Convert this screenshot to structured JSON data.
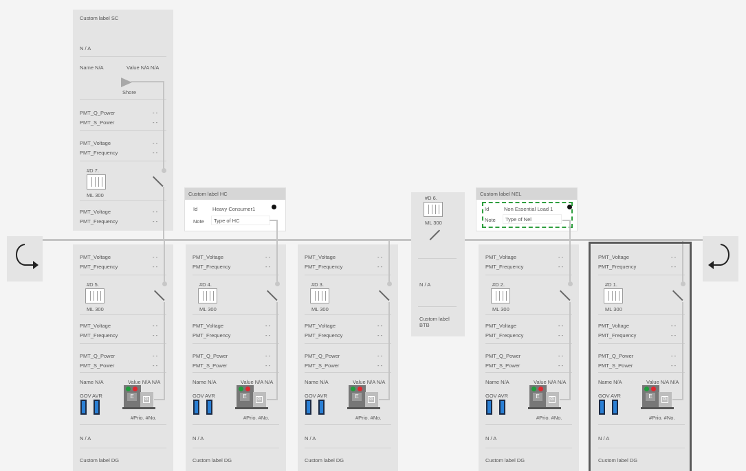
{
  "shore": {
    "label": "Custom label SC",
    "status": "N / A",
    "name": "Name N/A",
    "value": "Value N/A  N/A",
    "shore_text": "Shore",
    "q_power": "PMT_Q_Power",
    "s_power": "PMT_S_Power",
    "voltage": "PMT_Voltage",
    "frequency": "PMT_Frequency",
    "breaker_id": "#D 7.",
    "breaker_type": "ML 300",
    "voltage2": "PMT_Voltage",
    "frequency2": "PMT_Frequency",
    "dash": "- -"
  },
  "hc_card": {
    "header": "Custom label HC",
    "id_label": "Id",
    "id_value": "Heavy Consumer1",
    "note_label": "Note",
    "note_value": "Type of HC"
  },
  "nel_card": {
    "header": "Custom label NEL",
    "id_label": "Id",
    "id_value": "Non Essential Load 1",
    "note_label": "Note",
    "note_value": "Type of Nel"
  },
  "btb": {
    "breaker_id": "#D 6.",
    "breaker_type": "ML 300",
    "status": "N / A",
    "label": "Custom label BTB"
  },
  "generators": [
    {
      "voltage": "PMT_Voltage",
      "frequency": "PMT_Frequency",
      "breaker_id": "#D 5.",
      "breaker_type": "ML 300",
      "voltage2": "PMT_Voltage",
      "frequency2": "PMT_Frequency",
      "q_power": "PMT_Q_Power",
      "s_power": "PMT_S_Power",
      "name": "Name N/A",
      "value": "Value N/A  N/A",
      "gov": "GOV",
      "avr": "AVR",
      "prio": "#Prio. #No.",
      "status": "N / A",
      "label": "Custom label DG",
      "e": "E",
      "g": "G",
      "dash": "- -"
    },
    {
      "voltage": "PMT_Voltage",
      "frequency": "PMT_Frequency",
      "breaker_id": "#D 4.",
      "breaker_type": "ML 300",
      "voltage2": "PMT_Voltage",
      "frequency2": "PMT_Frequency",
      "q_power": "PMT_Q_Power",
      "s_power": "PMT_S_Power",
      "name": "Name N/A",
      "value": "Value N/A  N/A",
      "gov": "GOV",
      "avr": "AVR",
      "prio": "#Prio. #No.",
      "status": "N / A",
      "label": "Custom label DG",
      "e": "E",
      "g": "G",
      "dash": "- -"
    },
    {
      "voltage": "PMT_Voltage",
      "frequency": "PMT_Frequency",
      "breaker_id": "#D 3.",
      "breaker_type": "ML 300",
      "voltage2": "PMT_Voltage",
      "frequency2": "PMT_Frequency",
      "q_power": "PMT_Q_Power",
      "s_power": "PMT_S_Power",
      "name": "Name N/A",
      "value": "Value N/A  N/A",
      "gov": "GOV",
      "avr": "AVR",
      "prio": "#Prio. #No.",
      "status": "N / A",
      "label": "Custom label DG",
      "e": "E",
      "g": "G",
      "dash": "- -"
    },
    {
      "voltage": "PMT_Voltage",
      "frequency": "PMT_Frequency",
      "breaker_id": "#D 2.",
      "breaker_type": "ML 300",
      "voltage2": "PMT_Voltage",
      "frequency2": "PMT_Frequency",
      "q_power": "PMT_Q_Power",
      "s_power": "PMT_S_Power",
      "name": "Name N/A",
      "value": "Value N/A  N/A",
      "gov": "GOV",
      "avr": "AVR",
      "prio": "#Prio. #No.",
      "status": "N / A",
      "label": "Custom label DG",
      "e": "E",
      "g": "G",
      "dash": "- -"
    },
    {
      "voltage": "PMT_Voltage",
      "frequency": "PMT_Frequency",
      "breaker_id": "#D 1.",
      "breaker_type": "ML 300",
      "voltage2": "PMT_Voltage",
      "frequency2": "PMT_Frequency",
      "q_power": "PMT_Q_Power",
      "s_power": "PMT_S_Power",
      "name": "Name N/A",
      "value": "Value N/A  N/A",
      "gov": "GOV",
      "avr": "AVR",
      "prio": "#Prio. #No.",
      "status": "N / A",
      "label": "Custom label DG",
      "e": "E",
      "g": "G",
      "dash": "- -"
    }
  ],
  "icons": {
    "loop_left": "loop-arrow-left-icon",
    "loop_right": "loop-arrow-right-icon",
    "shore": "shore-triangle-icon"
  },
  "colors": {
    "selected_border": "#5a5a5a",
    "nel_dashed_border": "#2e9e3e",
    "led_green": "#1e9e3c",
    "led_red": "#e3262e",
    "gov_avr_blue": "#2a7fd4"
  }
}
